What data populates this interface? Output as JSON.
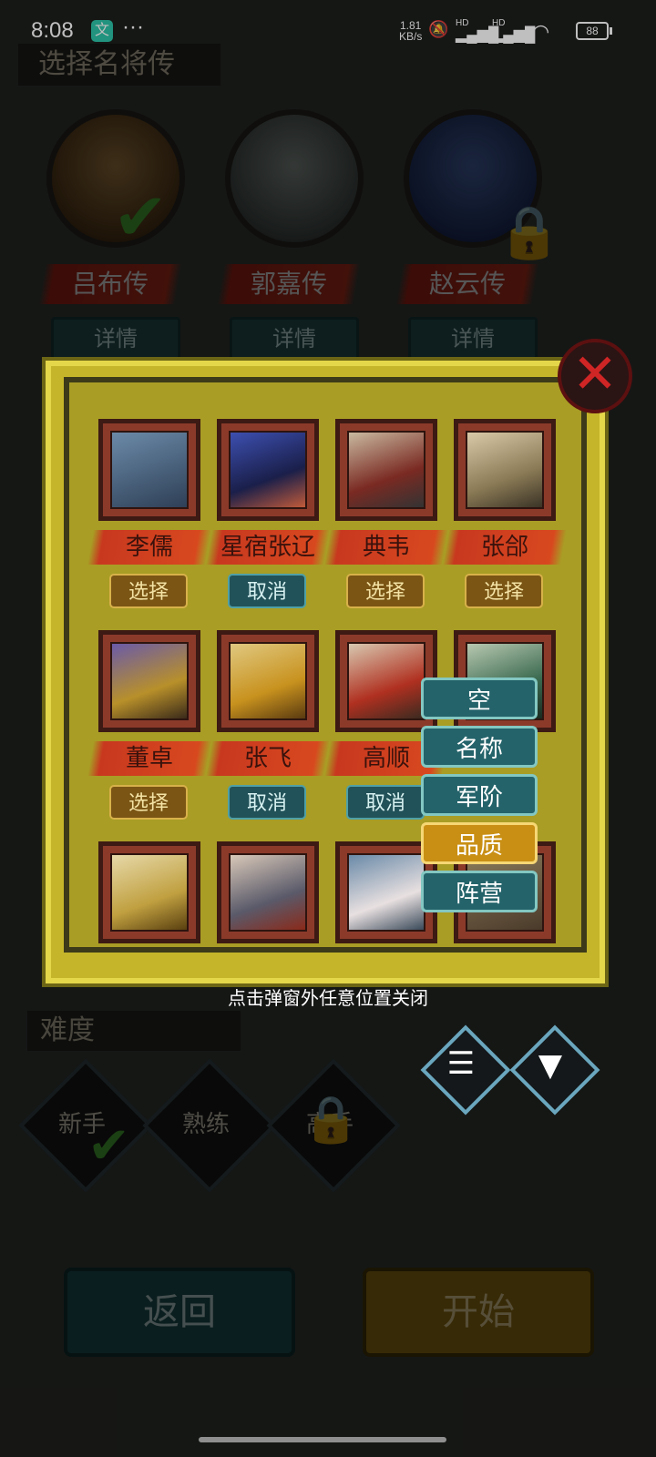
{
  "status_bar": {
    "time": "8:08",
    "app_badge": "文",
    "more": "···",
    "net_speed_value": "1.81",
    "net_speed_unit": "KB/s",
    "signal1": "HD",
    "signal2": "HD",
    "battery": "88"
  },
  "background": {
    "title": "选择名将传",
    "heroes": [
      {
        "name": "吕布传",
        "detail": "详情",
        "selected": true
      },
      {
        "name": "郭嘉传",
        "detail": "详情",
        "selected": false
      },
      {
        "name": "赵云传",
        "detail": "详情",
        "locked": true
      }
    ],
    "difficulty_label": "难度",
    "difficulties": [
      "新手",
      "熟练",
      "高手"
    ],
    "back_button": "返回",
    "start_button": "开始"
  },
  "popup": {
    "generals": [
      {
        "name": "李儒",
        "action": "选择",
        "state": "select"
      },
      {
        "name": "星宿张辽",
        "action": "取消",
        "state": "cancel"
      },
      {
        "name": "典韦",
        "action": "选择",
        "state": "select"
      },
      {
        "name": "张郃",
        "action": "选择",
        "state": "select"
      },
      {
        "name": "董卓",
        "action": "选择",
        "state": "select"
      },
      {
        "name": "张飞",
        "action": "取消",
        "state": "cancel"
      },
      {
        "name": "高顺",
        "action": "取消",
        "state": "cancel"
      }
    ],
    "sort_menu": {
      "options": [
        "空",
        "名称",
        "军阶",
        "品质",
        "阵营"
      ],
      "selected": "品质"
    },
    "close_icon": "close-icon"
  },
  "hint": "点击弹窗外任意位置关闭",
  "colors": {
    "frame": "#c4b52a",
    "select_btn": "#7a5514",
    "cancel_btn": "#225259",
    "menu_teal": "#24636a",
    "menu_gold": "#c98f14"
  }
}
